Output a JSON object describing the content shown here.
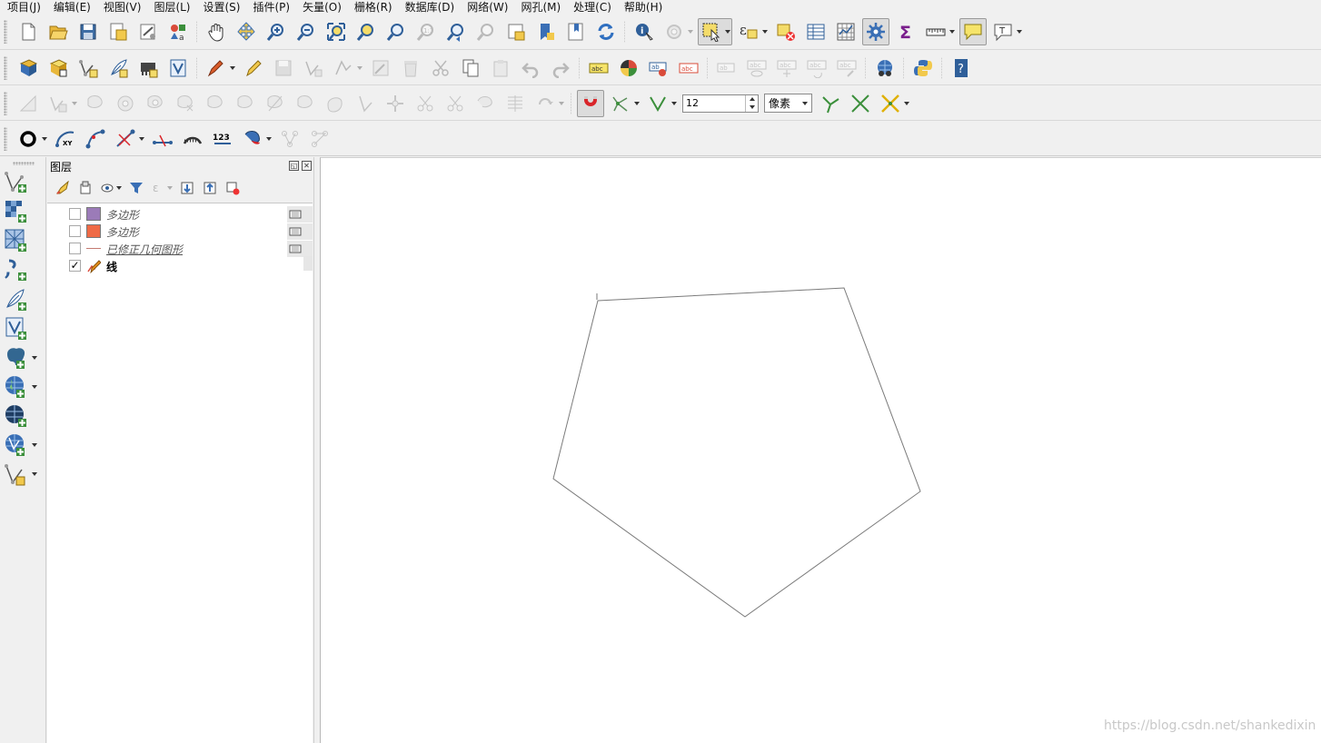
{
  "menu": [
    "项目(J)",
    "编辑(E)",
    "视图(V)",
    "图层(L)",
    "设置(S)",
    "插件(P)",
    "矢量(O)",
    "栅格(R)",
    "数据库(D)",
    "网络(W)",
    "网孔(M)",
    "处理(C)",
    "帮助(H)"
  ],
  "digitize": {
    "tolerance_value": "12",
    "unit": "像素"
  },
  "layers_panel": {
    "title": "图层",
    "layers": [
      {
        "name": "多边形",
        "checked": false,
        "symbol": "polygon",
        "color": "#9b7bb8"
      },
      {
        "name": "多边形",
        "checked": false,
        "symbol": "polygon",
        "color": "#ef6a45"
      },
      {
        "name": "已修正几何图形",
        "checked": false,
        "symbol": "line",
        "color": "#c47a72"
      },
      {
        "name": "线",
        "checked": true,
        "symbol": "editing-line",
        "color": "#e08a1a"
      }
    ]
  },
  "icons": {
    "toolbar1": [
      "new-project-icon",
      "open-project-icon",
      "save-project-icon",
      "save-as-icon",
      "print-layout-icon",
      "style-manager-icon",
      "pan-icon",
      "pan-to-selection-icon",
      "zoom-in-icon",
      "zoom-out-icon",
      "zoom-full-icon",
      "zoom-to-selection-icon",
      "zoom-to-layer-icon",
      "zoom-native-icon",
      "zoom-last-icon",
      "zoom-next-icon",
      "new-map-view-icon",
      "bookmark-new-icon",
      "bookmarks-icon",
      "refresh-icon",
      "identify-icon",
      "run-action-icon",
      "select-features-icon",
      "select-expression-icon",
      "deselect-icon",
      "attribute-table-icon",
      "field-calculator-icon",
      "processing-toolbox-icon",
      "statistics-icon",
      "measure-icon",
      "map-tips-icon",
      "text-annotation-icon"
    ],
    "toolbar2": [
      "data-source-manager-icon",
      "new-geopackage-icon",
      "new-shapefile-icon",
      "new-temporary-layer-icon",
      "new-virtual-layer-icon",
      "new-spatialite-icon",
      "current-edits-icon",
      "toggle-editing-icon",
      "save-edits-icon",
      "add-feature-icon",
      "vertex-tool-icon",
      "modify-attributes-icon",
      "delete-selected-icon",
      "cut-features-icon",
      "copy-features-icon",
      "paste-features-icon",
      "undo-icon",
      "redo-icon",
      "label-tool-icon",
      "diagram-tool-icon",
      "highlight-pinned-icon",
      "label-color-icon",
      "pin-labels-icon",
      "show-hide-labels-icon",
      "move-label-icon",
      "rotate-label-icon",
      "change-label-icon",
      "metasearch-icon",
      "python-console-icon",
      "help-icon"
    ],
    "toolbar3": [
      "offset-curve-icon",
      "add-ring-icon",
      "add-part-icon",
      "fill-ring-icon",
      "delete-ring-icon",
      "delete-part-icon",
      "reshape-icon",
      "offset-icon",
      "split-features-icon",
      "split-parts-icon",
      "merge-features-icon",
      "merge-attributes-icon",
      "rotate-symbols-icon",
      "simplify-icon",
      "reverse-line-icon",
      "move-feature-icon",
      "snapping-icon",
      "snap-to-layers-icon",
      "snap-vertex-icon",
      "tracing-icon",
      "intersection-icon",
      "self-snapping-icon"
    ],
    "toolbar4": [
      "circle-icon",
      "xy-curve-icon",
      "line-curve-icon",
      "vertex-curve-icon",
      "split-line-icon",
      "measure-line-icon",
      "numbering-icon",
      "shape-tool-icon",
      "node-split-icon",
      "network-icon"
    ],
    "left": [
      "add-vector-layer-icon",
      "add-raster-layer-icon",
      "add-mesh-layer-icon",
      "add-delimited-text-icon",
      "add-gpx-icon",
      "add-spatialite-icon",
      "add-postgis-icon",
      "add-wms-icon",
      "add-wcs-icon",
      "add-wfs-icon",
      "add-virtual-layer-icon"
    ],
    "panel_tools": [
      "open-layer-styling-icon",
      "add-group-icon",
      "manage-themes-icon",
      "filter-legend-icon",
      "filter-by-expression-icon",
      "expand-all-icon",
      "collapse-all-icon",
      "remove-layer-icon"
    ]
  },
  "watermark": "https://blog.csdn.net/shankedixin",
  "canvas": {
    "pentagon": [
      [
        305,
        157
      ],
      [
        576,
        143
      ],
      [
        660,
        367
      ],
      [
        467,
        505
      ],
      [
        256,
        353
      ]
    ]
  }
}
